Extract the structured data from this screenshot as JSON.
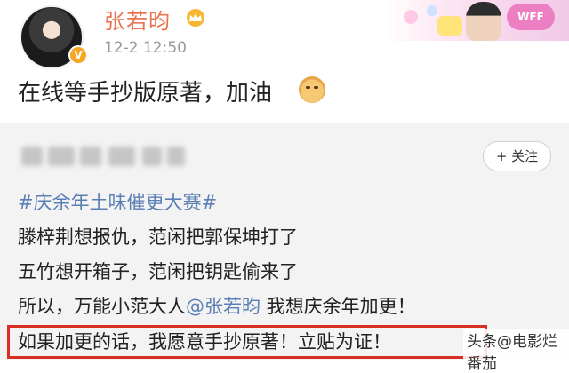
{
  "header": {
    "username": "张若昀",
    "verified_badge": "V",
    "timestamp": "12-2 12:50"
  },
  "decoration": {
    "badge_text": "WFF"
  },
  "post": {
    "text": "在线等手抄版原著，加油"
  },
  "repost": {
    "follow_label": "+ 关注",
    "topic": "#庆余年土味催更大赛#",
    "line1": "滕梓荆想报仇，范闲把郭保坤打了",
    "line2": "五竹想开箱子，范闲把钥匙偷来了",
    "line3_prefix": "所以，万能小范大人",
    "line3_mention": "@张若昀",
    "line3_suffix": " 我想庆余年加更！",
    "line4": "如果加更的话，我愿意手抄原著！立贴为证！"
  },
  "watermark": "头条@电影烂番茄",
  "colors": {
    "username": "#eb7350",
    "topic_link": "#5b7fb5",
    "highlight_border": "#d93025",
    "repost_bg": "#f3f3f3"
  }
}
